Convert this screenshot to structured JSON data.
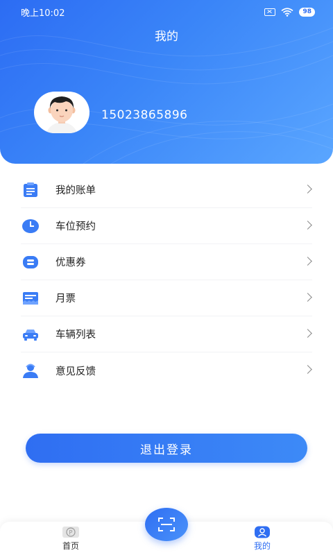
{
  "status_bar": {
    "time": "晚上10:02",
    "battery": "98"
  },
  "header": {
    "title": "我的"
  },
  "user": {
    "phone": "15023865896"
  },
  "menu": {
    "items": [
      {
        "label": "我的账单",
        "icon": "bill-icon"
      },
      {
        "label": "车位预约",
        "icon": "clock-icon"
      },
      {
        "label": "优惠券",
        "icon": "coupon-icon"
      },
      {
        "label": "月票",
        "icon": "ticket-icon"
      },
      {
        "label": "车辆列表",
        "icon": "car-icon"
      },
      {
        "label": "意见反馈",
        "icon": "feedback-icon"
      }
    ]
  },
  "logout_label": "退出登录",
  "bottom_nav": {
    "home_label": "首页",
    "mine_label": "我的",
    "scan_icon": "scan-icon"
  },
  "colors": {
    "primary": "#2f6ef2",
    "icon_blue": "#3a7cf5"
  }
}
